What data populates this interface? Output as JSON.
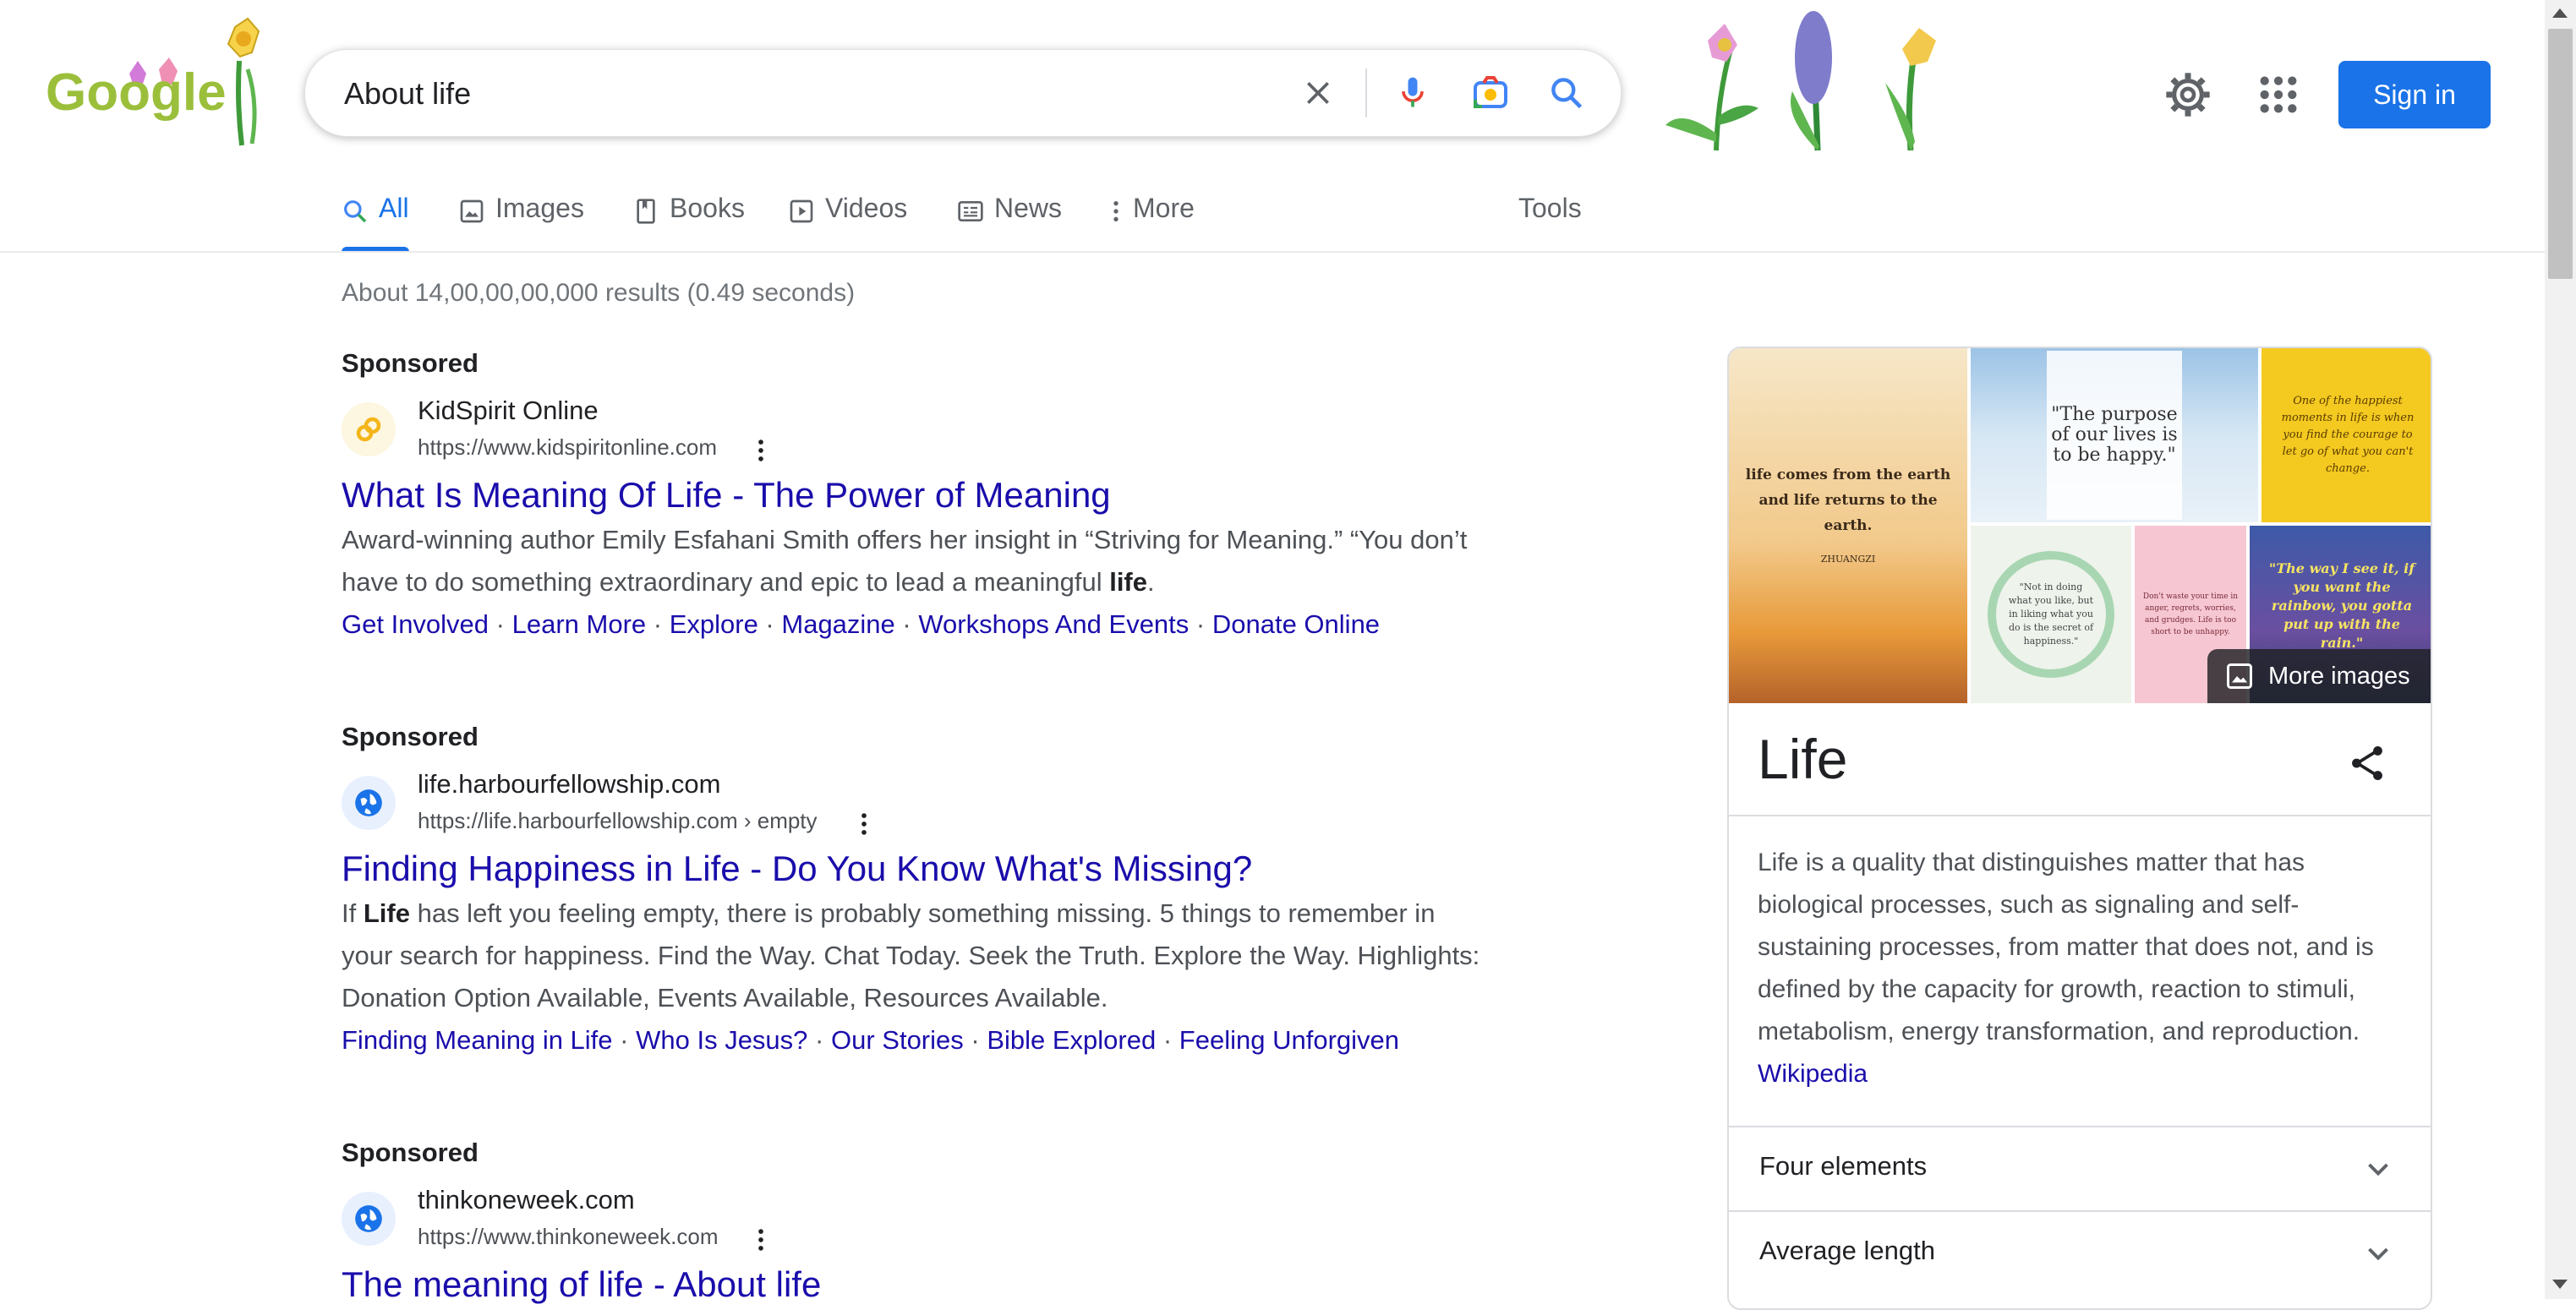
{
  "header": {
    "logo_text": "Google",
    "search_query": "About life",
    "sign_in_label": "Sign in"
  },
  "tabs": [
    {
      "label": "All",
      "icon": "search-icon",
      "active": true
    },
    {
      "label": "Images",
      "icon": "image-icon",
      "active": false
    },
    {
      "label": "Books",
      "icon": "book-icon",
      "active": false
    },
    {
      "label": "Videos",
      "icon": "play-icon",
      "active": false
    },
    {
      "label": "News",
      "icon": "news-icon",
      "active": false
    },
    {
      "label": "More",
      "icon": "more-vert-icon",
      "active": false
    }
  ],
  "tools_label": "Tools",
  "result_stats": "About 14,00,00,00,000 results (0.49 seconds)",
  "ads": [
    {
      "sponsored": "Sponsored",
      "site_name": "KidSpirit Online",
      "url": "https://www.kidspiritonline.com",
      "title": "What Is Meaning Of Life - The Power of Meaning",
      "desc_pre": "Award-winning author Emily Esfahani Smith offers her insight in “Striving for Meaning.” “You don’t have to do something extraordinary and epic to lead a meaningful ",
      "desc_bold": "life",
      "desc_post": ".",
      "links": [
        "Get Involved",
        "Learn More",
        "Explore",
        "Magazine",
        "Workshops And Events",
        "Donate Online"
      ]
    },
    {
      "sponsored": "Sponsored",
      "site_name": "life.harbourfellowship.com",
      "url": "https://life.harbourfellowship.com › empty",
      "title": "Finding Happiness in Life - Do You Know What's Missing?",
      "desc_pre": "If ",
      "desc_bold": "Life",
      "desc_post": " has left you feeling empty, there is probably something missing. 5 things to remember in your search for happiness. Find the Way. Chat Today. Seek the Truth. Explore the Way. Highlights: Donation Option Available, Events Available, Resources Available.",
      "links": [
        "Finding Meaning in Life",
        "Who Is Jesus?",
        "Our Stories",
        "Bible Explored",
        "Feeling Unforgiven"
      ]
    },
    {
      "sponsored": "Sponsored",
      "site_name": "thinkoneweek.com",
      "url": "https://www.thinkoneweek.com",
      "title": "The meaning of life - About life"
    }
  ],
  "knowledge_panel": {
    "images": [
      {
        "caption": "life comes from the earth and life returns to the earth.",
        "author": "ZHUANGZI"
      },
      {
        "caption": "\"The purpose of our lives is to be happy.\""
      },
      {
        "caption": "One of the happiest moments in life is when you find the courage to let go of what you can't change."
      },
      {
        "caption": "\"Not in doing what you like, but in liking what you do is the secret of happiness.\""
      },
      {
        "caption": "Don't waste your time in anger, regrets, worries, and grudges. Life is too short to be unhappy."
      },
      {
        "caption": "\"The way I see it, if you want the rainbow, you gotta put up with the rain.\""
      }
    ],
    "more_images_label": "More images",
    "title": "Life",
    "description": "Life is a quality that distinguishes matter that has biological processes, such as signaling and self-sustaining processes, from matter that does not, and is defined by the capacity for growth, reaction to stimuli, metabolism, energy transformation, and reproduction.",
    "source_link": "Wikipedia",
    "rows": [
      "Four elements",
      "Average length"
    ]
  },
  "colors": {
    "link": "#1a0dab",
    "accent": "#1a73e8",
    "text": "#202124",
    "secondary_text": "#4d5156"
  }
}
